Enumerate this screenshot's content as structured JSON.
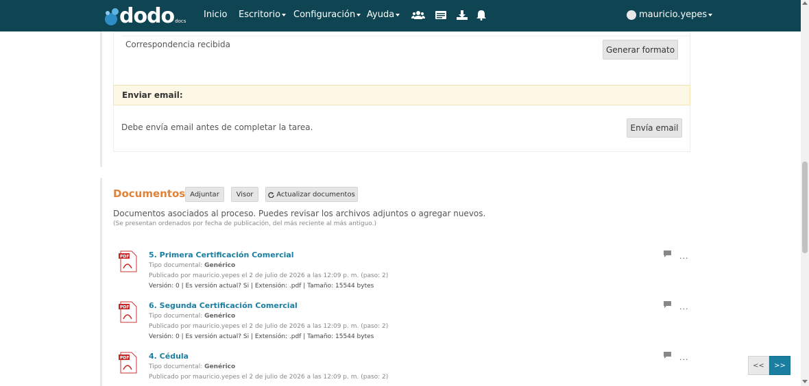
{
  "navbar": {
    "logo_text": "dodo",
    "logo_sub": "docs",
    "items": [
      {
        "label": "Inicio",
        "dropdown": false
      },
      {
        "label": "Escritorio",
        "dropdown": true
      },
      {
        "label": "Configuración",
        "dropdown": true
      },
      {
        "label": "Ayuda",
        "dropdown": true
      }
    ],
    "icons": [
      "users-icon",
      "id-card-icon",
      "download-icon",
      "bell-icon"
    ],
    "user": "mauricio.yepes",
    "bg_color": "#0f4552"
  },
  "correspondencia": {
    "label": "Correspondencia recibida",
    "button": "Generar formato"
  },
  "email": {
    "title": "Enviar email:",
    "message": "Debe envía email antes de completar la tarea.",
    "button": "Envía email"
  },
  "documentos": {
    "title": "Documentos",
    "buttons": {
      "adjuntar": "Adjuntar",
      "visor": "Visor",
      "actualizar": "Actualizar documentos"
    },
    "description": "Documentos asociados al proceso. Puedes revisar los archivos adjuntos o agregar nuevos.",
    "note": "(Se presentan ordenados por fecha de publicación, del más reciente al más antiguo.)",
    "items": [
      {
        "title": "5. Primera Certificación Comercial",
        "tipo_label": "Tipo documental:",
        "tipo": "Genérico",
        "publicado": "Publicado por mauricio.yepes el 2 de julio de 2026 a las 12:09 p. m. (paso: 2)",
        "meta": "Versión: 0 | Es versión actual? Si | Extensión: .pdf | Tamaño: 15544 bytes"
      },
      {
        "title": "6. Segunda Certificación Comercial",
        "tipo_label": "Tipo documental:",
        "tipo": "Genérico",
        "publicado": "Publicado por mauricio.yepes el 2 de julio de 2026 a las 12:09 p. m. (paso: 2)",
        "meta": "Versión: 0 | Es versión actual? Si | Extensión: .pdf | Tamaño: 15544 bytes"
      },
      {
        "title": "4. Cédula",
        "tipo_label": "Tipo documental:",
        "tipo": "Genérico",
        "publicado": "Publicado por mauricio.yepes el 2 de julio de 2026 a las 12:09 p. m. (paso: 2)"
      }
    ],
    "dots": "...",
    "accent_color": "#e0833a",
    "link_color": "#1a7ea1"
  },
  "pager": {
    "prev": "<<",
    "next": ">>"
  }
}
